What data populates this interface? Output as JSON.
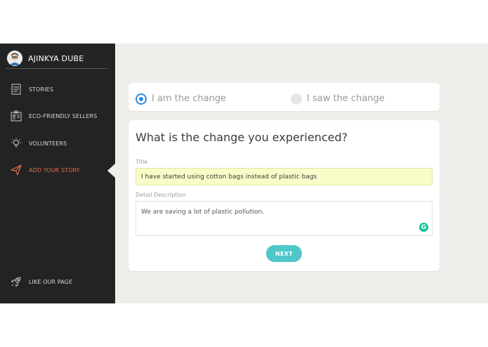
{
  "user": {
    "name": "AJINKYA DUBE",
    "avatar_icon": "avatar-icon"
  },
  "sidebar": {
    "items": [
      {
        "label": "STORIES",
        "icon": "document-icon"
      },
      {
        "label": "ECO-FRIENDLY SELLERS",
        "icon": "seller-badge-icon"
      },
      {
        "label": "VOLUNTEERS",
        "icon": "lightbulb-icon"
      },
      {
        "label": "ADD YOUR STORY",
        "icon": "send-icon",
        "active": true
      },
      {
        "label": "LIKE OUR PAGE",
        "icon": "rocket-icon"
      }
    ],
    "active_color": "#e36e4a"
  },
  "choice": {
    "option_1": "I am the change",
    "option_2": "I saw the change",
    "selected": "option_1"
  },
  "form": {
    "heading": "What is the change you experienced?",
    "title_label": "Title",
    "title_value": "I have started using cotton bags instead of plastic bags",
    "description_label": "Detail Description",
    "description_value": "We are saving a lot of plastic pollution.",
    "grammarly_letter": "G",
    "next_label": "NEXT"
  },
  "colors": {
    "sidebar_bg": "#232323",
    "accent": "#4fc6c9",
    "radio": "#2f8ad9",
    "title_field_bg": "#fafcc8"
  }
}
